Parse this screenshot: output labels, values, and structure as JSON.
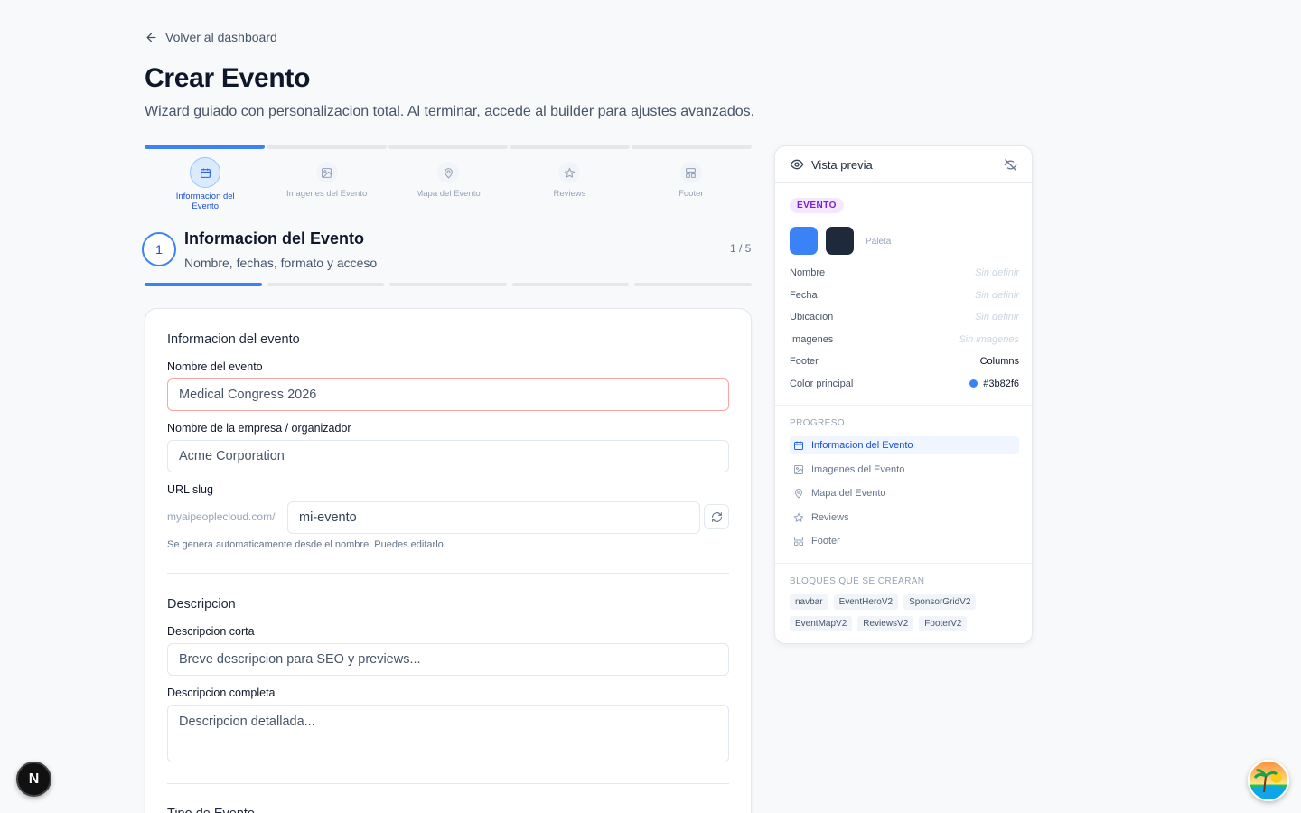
{
  "nav": {
    "back_label": "Volver al dashboard"
  },
  "page": {
    "title": "Crear Evento",
    "subtitle": "Wizard guiado con personalizacion total. Al terminar, accede al builder para ajustes avanzados."
  },
  "stepper": {
    "steps": [
      {
        "label": "Informacion del Evento",
        "icon": "calendar-icon",
        "active": true
      },
      {
        "label": "Imagenes del Evento",
        "icon": "image-icon",
        "active": false
      },
      {
        "label": "Mapa del Evento",
        "icon": "map-pin-icon",
        "active": false
      },
      {
        "label": "Reviews",
        "icon": "star-icon",
        "active": false
      },
      {
        "label": "Footer",
        "icon": "layout-icon",
        "active": false
      }
    ]
  },
  "step_header": {
    "number": "1",
    "title": "Informacion del Evento",
    "subtitle": "Nombre, fechas, formato y acceso",
    "count": "1 / 5"
  },
  "form": {
    "section_info": "Informacion del evento",
    "event_name_label": "Nombre del evento",
    "event_name_placeholder": "Medical Congress 2026",
    "company_label": "Nombre de la empresa / organizador",
    "company_placeholder": "Acme Corporation",
    "slug_label": "URL slug",
    "slug_prefix": "myaipeoplecloud.com/",
    "slug_value": "mi-evento",
    "slug_hint": "Se genera automaticamente desde el nombre. Puedes editarlo.",
    "section_desc": "Descripcion",
    "short_desc_label": "Descripcion corta",
    "short_desc_placeholder": "Breve descripcion para SEO y previews...",
    "full_desc_label": "Descripcion completa",
    "full_desc_placeholder": "Descripcion detallada...",
    "section_type": "Tipo de Evento"
  },
  "preview": {
    "title": "Vista previa",
    "badge": "EVENTO",
    "palette_label": "Paleta",
    "colors": {
      "primary": "#3b82f6",
      "secondary": "#1e293b"
    },
    "fields": [
      {
        "key": "Nombre",
        "value": "Sin definir"
      },
      {
        "key": "Fecha",
        "value": "Sin definir"
      },
      {
        "key": "Ubicacion",
        "value": "Sin definir"
      },
      {
        "key": "Imagenes",
        "value": "Sin imagenes"
      },
      {
        "key": "Footer",
        "value": "Columns"
      },
      {
        "key": "Color principal",
        "value": "#3b82f6"
      }
    ],
    "progress_title": "PROGRESO",
    "progress": [
      {
        "label": "Informacion del Evento",
        "icon": "calendar-icon"
      },
      {
        "label": "Imagenes del Evento",
        "icon": "image-icon"
      },
      {
        "label": "Mapa del Evento",
        "icon": "map-pin-icon"
      },
      {
        "label": "Reviews",
        "icon": "star-icon"
      },
      {
        "label": "Footer",
        "icon": "layout-icon"
      }
    ],
    "blocks_title": "BLOQUES QUE SE CREARAN",
    "blocks": [
      "navbar",
      "EventHeroV2",
      "SponsorGridV2",
      "EventMapV2",
      "ReviewsV2",
      "FooterV2"
    ]
  },
  "floating": {
    "dev_button": "N"
  }
}
